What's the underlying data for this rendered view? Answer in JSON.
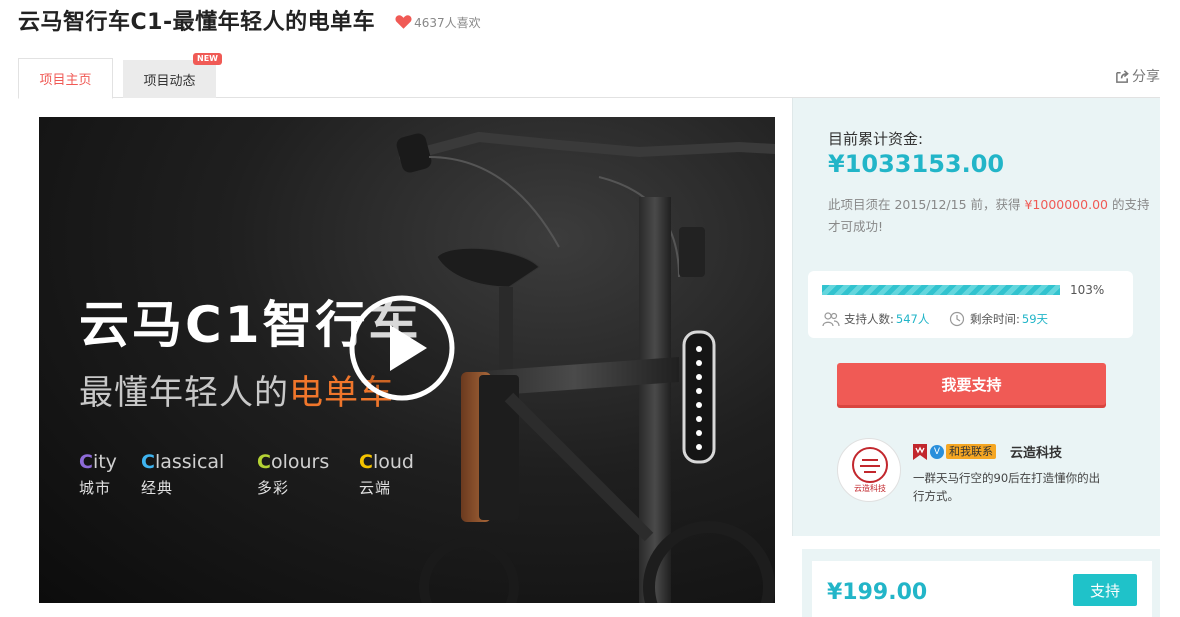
{
  "header": {
    "title": "云马智行车C1-最懂年轻人的电单车",
    "likes": "4637人喜欢"
  },
  "tabs": {
    "home": "项目主页",
    "news": "项目动态",
    "news_badge": "NEW",
    "share": "分享"
  },
  "video": {
    "brand": "云马C1智行车",
    "tagline_prefix": "最懂年轻人的",
    "tagline_accent": "电单车",
    "features": [
      {
        "initial": "C",
        "rest": "ity",
        "cn": "城市",
        "color": "#8e6bd8"
      },
      {
        "initial": "C",
        "rest": "lassical",
        "cn": "经典",
        "color": "#3fb4f0"
      },
      {
        "initial": "C",
        "rest": "olours",
        "cn": "多彩",
        "color": "#b5d334"
      },
      {
        "initial": "C",
        "rest": "loud",
        "cn": "云端",
        "color": "#f5c400"
      }
    ]
  },
  "funding": {
    "label": "目前累计资金:",
    "amount": "¥1033153.00",
    "desc_prefix": "此项目须在 2015/12/15 前，获得 ",
    "goal": "¥1000000.00",
    "desc_suffix": " 的支持才可成功!",
    "progress_percent": 103,
    "progress_label": "103%",
    "supporters_label": "支持人数:",
    "supporters": "547人",
    "time_label": "剩余时间:",
    "time_left": "59天",
    "support_button": "我要支持"
  },
  "organizer": {
    "logo_text": "云造科技",
    "contact": "和我联系",
    "name": "云造科技",
    "desc": "一群天马行空的90后在打造懂你的出行方式。"
  },
  "reward": {
    "price": "¥199.00",
    "button": "支持"
  },
  "colors": {
    "accent_red": "#f05a55",
    "accent_teal": "#22b5c8",
    "sidebar_bg": "#eaf4f5"
  }
}
